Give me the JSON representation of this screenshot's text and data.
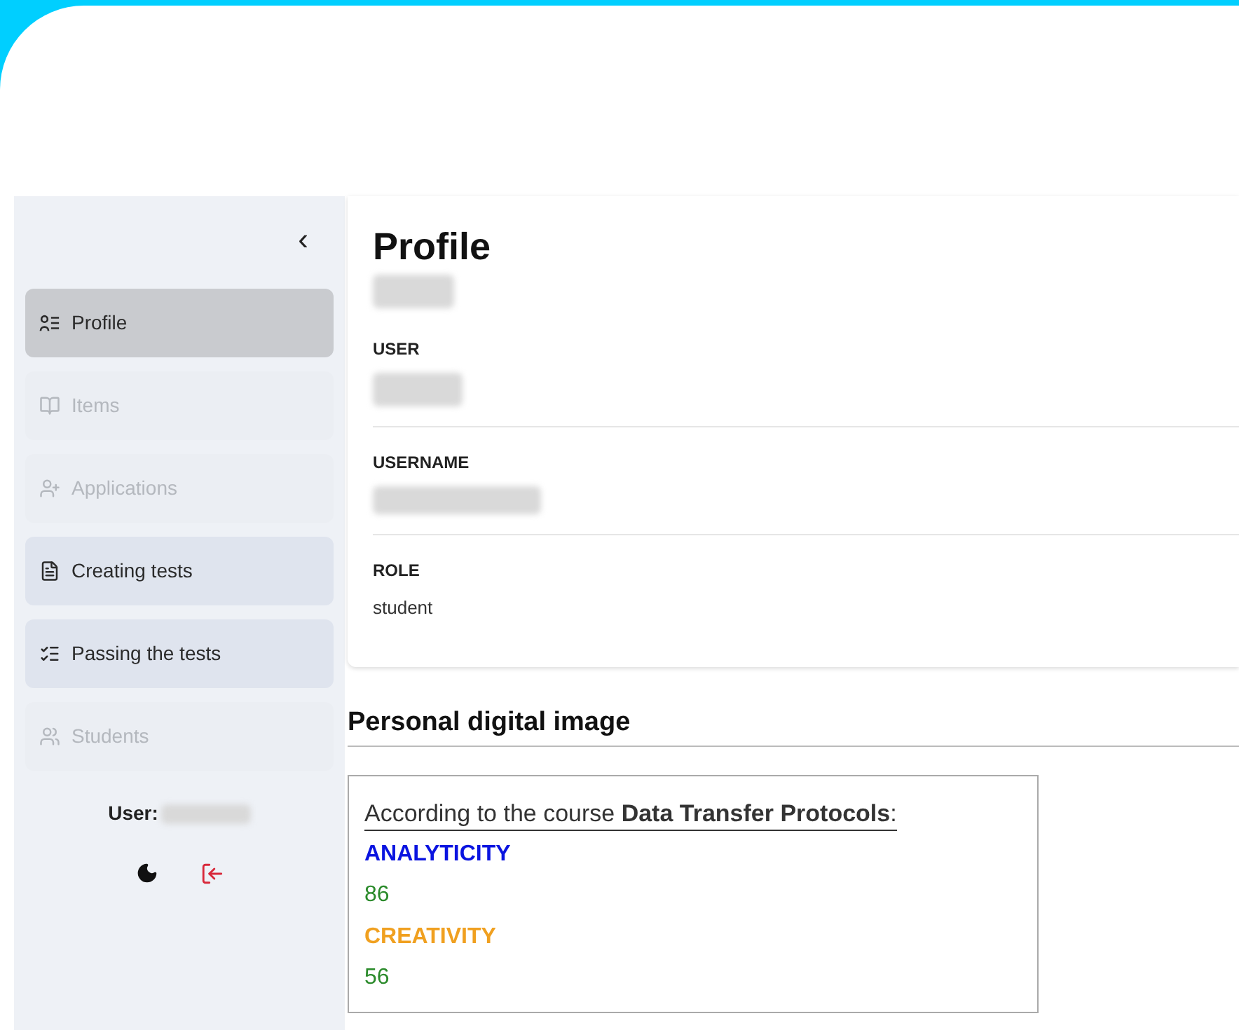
{
  "sidebar": {
    "collapse_icon": "‹",
    "items": [
      {
        "label": "Profile",
        "kind": "profile",
        "selected": true,
        "disabled": false
      },
      {
        "label": "Items",
        "kind": "items",
        "selected": false,
        "disabled": true
      },
      {
        "label": "Applications",
        "kind": "applications",
        "selected": false,
        "disabled": true
      },
      {
        "label": "Creating tests",
        "kind": "creating",
        "selected": false,
        "disabled": false
      },
      {
        "label": "Passing the tests",
        "kind": "passing",
        "selected": false,
        "disabled": false
      },
      {
        "label": "Students",
        "kind": "students",
        "selected": false,
        "disabled": true
      }
    ],
    "user_label": "User:",
    "user_redacted": true
  },
  "profile": {
    "title": "Profile",
    "subtitle_redacted": true,
    "fields": [
      {
        "label": "USER",
        "redacted": true
      },
      {
        "label": "USERNAME",
        "redacted": true
      },
      {
        "label": "ROLE",
        "value": "student",
        "redacted": false
      }
    ]
  },
  "digital_image": {
    "title": "Personal digital image",
    "course_line": "According to the course **Data Transfer Protocols**:",
    "metrics": [
      {
        "name": "ANALYTICITY",
        "color": "#0a14e0",
        "value": "86"
      },
      {
        "name": "CREATIVITY",
        "color": "#f0a020",
        "value": "56"
      }
    ]
  }
}
